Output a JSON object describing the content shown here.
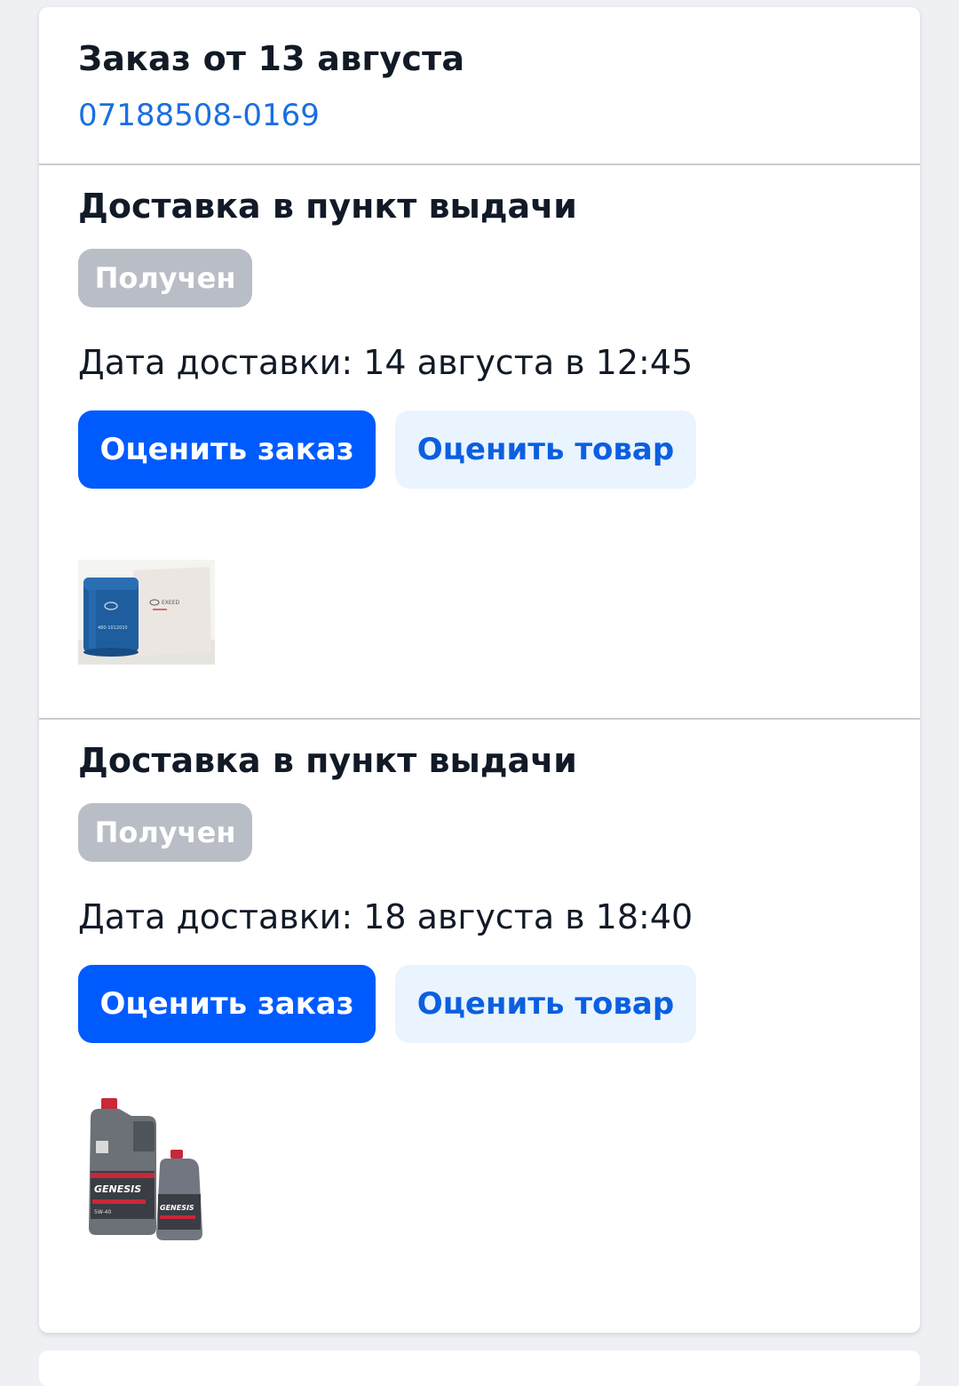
{
  "order": {
    "title": "Заказ от 13 августа",
    "number": "07188508-0169"
  },
  "shipments": [
    {
      "title": "Доставка в пункт выдачи",
      "status": "Получен",
      "delivery_date": "Дата доставки: 14 августа в 12:45",
      "rate_order_label": "Оценить заказ",
      "rate_product_label": "Оценить товар",
      "product_image": "oil-filter-with-box"
    },
    {
      "title": "Доставка в пункт выдачи",
      "status": "Получен",
      "delivery_date": "Дата доставки: 18 августа в 18:40",
      "rate_order_label": "Оценить заказ",
      "rate_product_label": "Оценить товар",
      "product_image": "engine-oil-canisters"
    }
  ],
  "colors": {
    "accent": "#005bff",
    "link": "#1a6fe0",
    "secondary_button_bg": "#e9f4ff",
    "badge_bg": "#b9bec6"
  }
}
